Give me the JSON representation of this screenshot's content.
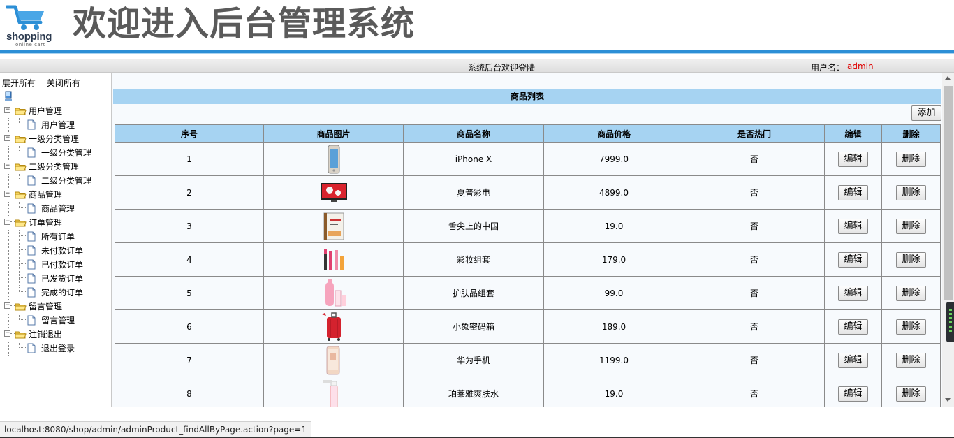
{
  "header": {
    "logo_text": "shopping",
    "logo_subtext": "online cart",
    "title": "欢迎进入后台管理系统"
  },
  "welcome_bar": {
    "message": "系统后台欢迎登陆",
    "user_label": "用户名：",
    "username": "admin"
  },
  "sidebar": {
    "expand_all": "展开所有",
    "collapse_all": "关闭所有",
    "groups": [
      {
        "label": "用户管理",
        "items": [
          "用户管理"
        ]
      },
      {
        "label": "一级分类管理",
        "items": [
          "一级分类管理"
        ]
      },
      {
        "label": "二级分类管理",
        "items": [
          "二级分类管理"
        ]
      },
      {
        "label": "商品管理",
        "items": [
          "商品管理"
        ]
      },
      {
        "label": "订单管理",
        "items": [
          "所有订单",
          "未付款订单",
          "已付款订单",
          "已发货订单",
          "完成的订单"
        ]
      },
      {
        "label": "留言管理",
        "items": [
          "留言管理"
        ]
      },
      {
        "label": "注销退出",
        "items": [
          "退出登录"
        ]
      }
    ]
  },
  "main": {
    "list_title": "商品列表",
    "add_button": "添加",
    "columns": [
      "序号",
      "商品图片",
      "商品名称",
      "商品价格",
      "是否热门",
      "编辑",
      "删除"
    ],
    "edit_label": "编辑",
    "delete_label": "删除",
    "rows": [
      {
        "no": "1",
        "image": "phone-image",
        "name": "iPhone X",
        "price": "7999.0",
        "hot": "否"
      },
      {
        "no": "2",
        "image": "tv-image",
        "name": "夏普彩电",
        "price": "4899.0",
        "hot": "否"
      },
      {
        "no": "3",
        "image": "book-image",
        "name": "舌尖上的中国",
        "price": "19.0",
        "hot": "否"
      },
      {
        "no": "4",
        "image": "cosmetics-image",
        "name": "彩妆组套",
        "price": "179.0",
        "hot": "否"
      },
      {
        "no": "5",
        "image": "skincare-image",
        "name": "护肤品组套",
        "price": "99.0",
        "hot": "否"
      },
      {
        "no": "6",
        "image": "luggage-image",
        "name": "小象密码箱",
        "price": "189.0",
        "hot": "否"
      },
      {
        "no": "7",
        "image": "huawei-phone-image",
        "name": "华为手机",
        "price": "1199.0",
        "hot": "否"
      },
      {
        "no": "8",
        "image": "toner-image",
        "name": "珀莱雅爽肤水",
        "price": "19.0",
        "hot": "否"
      }
    ]
  },
  "statusbar": {
    "url": "localhost:8080/shop/admin/adminProduct_findAllByPage.action?page=1"
  },
  "colors": {
    "accent_blue": "#2c8fd6",
    "header_cell": "#a6d3f2",
    "username_red": "#e00000"
  }
}
